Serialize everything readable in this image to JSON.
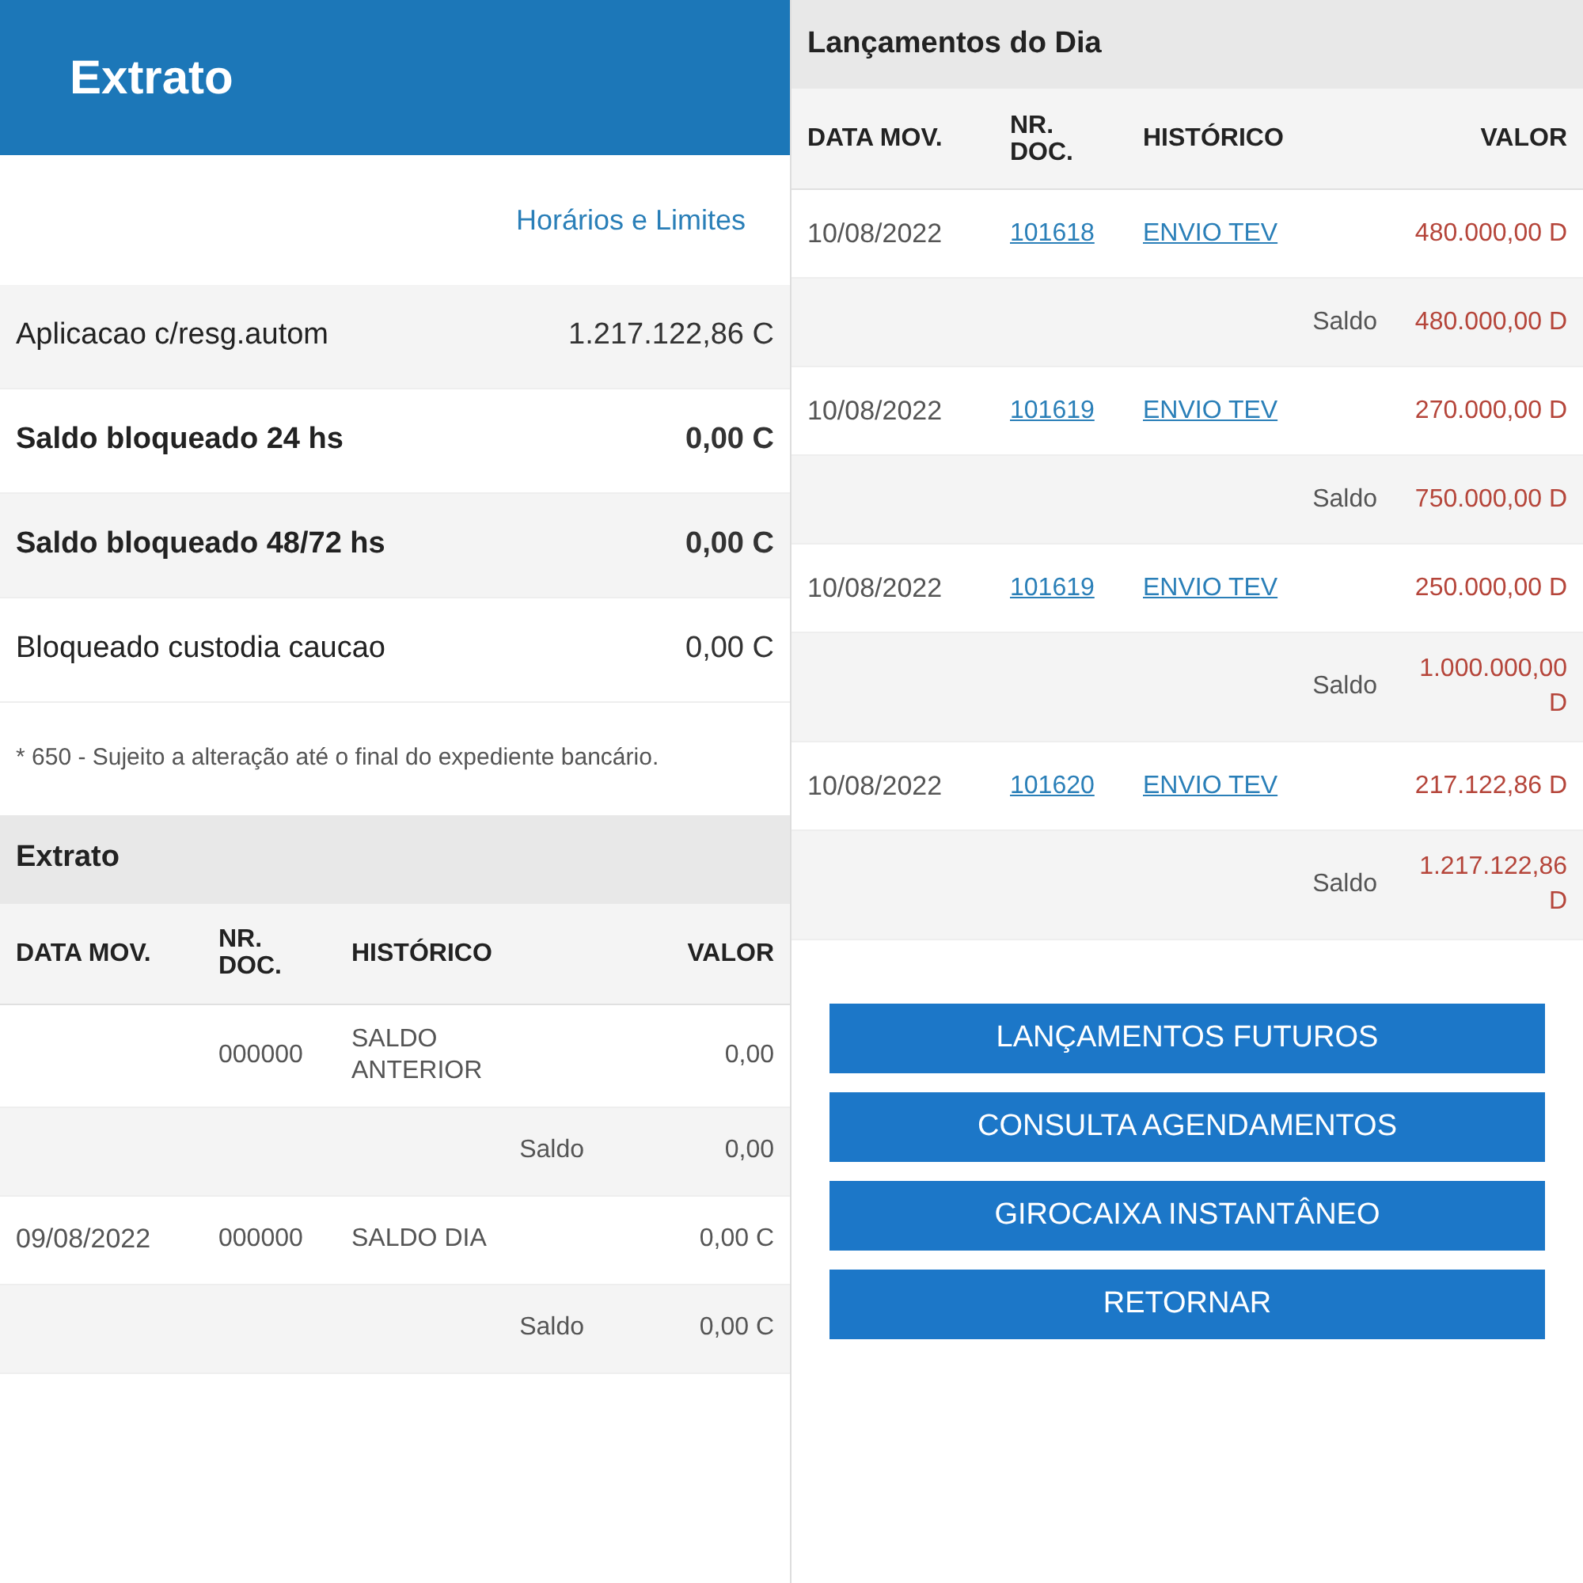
{
  "left": {
    "header": {
      "title": "Extrato"
    },
    "link": "Horários e Limites",
    "summary": [
      {
        "label": "Aplicacao c/resg.autom",
        "value": "1.217.122,86 C",
        "bold": false
      },
      {
        "label": "Saldo bloqueado 24 hs",
        "value": "0,00 C",
        "bold": true
      },
      {
        "label": "Saldo bloqueado 48/72 hs",
        "value": "0,00 C",
        "bold": true
      },
      {
        "label": "Bloqueado custodia caucao",
        "value": "0,00 C",
        "bold": false
      }
    ],
    "note": "* 650 - Sujeito a alteração até o final do expediente bancário.",
    "section": {
      "title": "Extrato",
      "columns": [
        "DATA MOV.",
        "NR. DOC.",
        "HISTÓRICO",
        "VALOR"
      ],
      "rows": [
        {
          "kind": "entry",
          "date": "",
          "doc": "000000",
          "history": "SALDO ANTERIOR",
          "value": "0,00",
          "linked": false,
          "negative": false
        },
        {
          "kind": "balance",
          "label": "Saldo",
          "value": "0,00",
          "negative": false
        },
        {
          "kind": "entry",
          "date": "09/08/2022",
          "doc": "000000",
          "history": "SALDO DIA",
          "value": "0,00 C",
          "linked": false,
          "negative": false
        },
        {
          "kind": "balance",
          "label": "Saldo",
          "value": "0,00 C",
          "negative": false
        }
      ]
    }
  },
  "right": {
    "section": {
      "title": "Lançamentos do Dia",
      "columns": [
        "DATA MOV.",
        "NR. DOC.",
        "HISTÓRICO",
        "VALOR"
      ],
      "rows": [
        {
          "kind": "entry",
          "date": "10/08/2022",
          "doc": "101618",
          "history": "ENVIO TEV",
          "value": "480.000,00 D",
          "linked": true,
          "negative": true
        },
        {
          "kind": "balance",
          "label": "Saldo",
          "value": "480.000,00 D",
          "negative": true
        },
        {
          "kind": "entry",
          "date": "10/08/2022",
          "doc": "101619",
          "history": "ENVIO TEV",
          "value": "270.000,00 D",
          "linked": true,
          "negative": true
        },
        {
          "kind": "balance",
          "label": "Saldo",
          "value": "750.000,00 D",
          "negative": true
        },
        {
          "kind": "entry",
          "date": "10/08/2022",
          "doc": "101619",
          "history": "ENVIO TEV",
          "value": "250.000,00 D",
          "linked": true,
          "negative": true
        },
        {
          "kind": "balance",
          "label": "Saldo",
          "value": "1.000.000,00 D",
          "negative": true
        },
        {
          "kind": "entry",
          "date": "10/08/2022",
          "doc": "101620",
          "history": "ENVIO TEV",
          "value": "217.122,86 D",
          "linked": true,
          "negative": true
        },
        {
          "kind": "balance",
          "label": "Saldo",
          "value": "1.217.122,86 D",
          "negative": true
        }
      ]
    },
    "buttons": [
      "LANÇAMENTOS FUTUROS",
      "CONSULTA AGENDAMENTOS",
      "GIROCAIXA INSTANTÂNEO",
      "RETORNAR"
    ]
  }
}
